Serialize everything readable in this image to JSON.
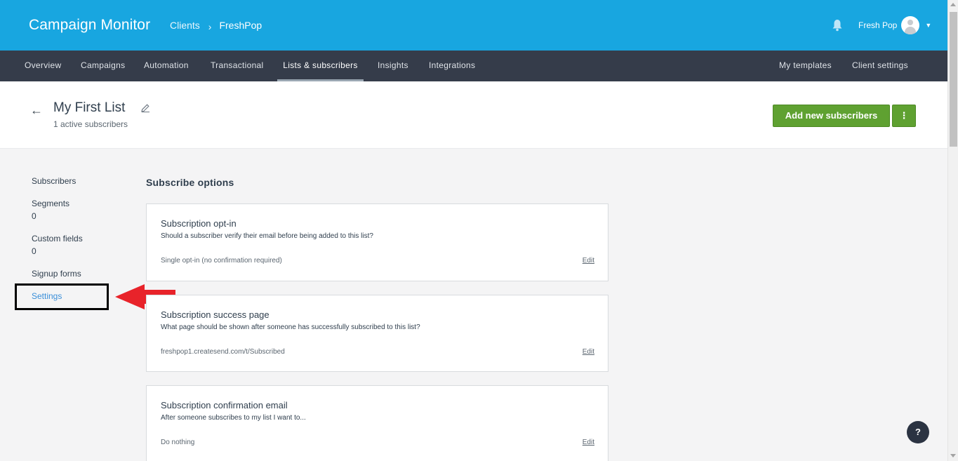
{
  "header": {
    "brand": "Campaign Monitor",
    "breadcrumb": [
      "Clients",
      "FreshPop"
    ],
    "breadcrumb_separator": "›",
    "user_name": "Fresh Pop",
    "icons": [
      "bell-icon",
      "avatar",
      "caret-down-icon"
    ]
  },
  "nav": {
    "left": [
      "Overview",
      "Campaigns",
      "Automation",
      "Transactional",
      "Lists & subscribers",
      "Insights",
      "Integrations"
    ],
    "active": "Lists & subscribers",
    "right": [
      "My templates",
      "Client settings"
    ]
  },
  "page": {
    "back_icon": "←",
    "title": "My First List",
    "subscriber_count": "1 active subscribers",
    "add_button": "Add new subscribers",
    "more_button": "⋮"
  },
  "sidebar": {
    "items": [
      {
        "label": "Subscribers",
        "count": ""
      },
      {
        "label": "Segments",
        "count": "0"
      },
      {
        "label": "Custom fields",
        "count": "0"
      },
      {
        "label": "Signup forms",
        "count": ""
      },
      {
        "label": "Settings",
        "count": ""
      }
    ],
    "active": "Settings"
  },
  "main": {
    "section_title": "Subscribe options",
    "cards": [
      {
        "title": "Subscription opt-in",
        "description": "Should a subscriber verify their email before being added to this list?",
        "value": "Single opt-in (no confirmation required)",
        "action": "Edit"
      },
      {
        "title": "Subscription success page",
        "description": "What page should be shown after someone has successfully subscribed to this list?",
        "value": "freshpop1.createsend.com/t/Subscribed",
        "action": "Edit"
      },
      {
        "title": "Subscription confirmation email",
        "description": "After someone subscribes to my list I want to...",
        "value": "Do nothing",
        "action": "Edit"
      }
    ]
  },
  "help_button": "?",
  "colors": {
    "topbar": "#18a6e0",
    "navbar": "#353c4a",
    "primary_button": "#5fa131",
    "link_active": "#3a8fd9",
    "annotation_arrow": "#e8232a"
  }
}
